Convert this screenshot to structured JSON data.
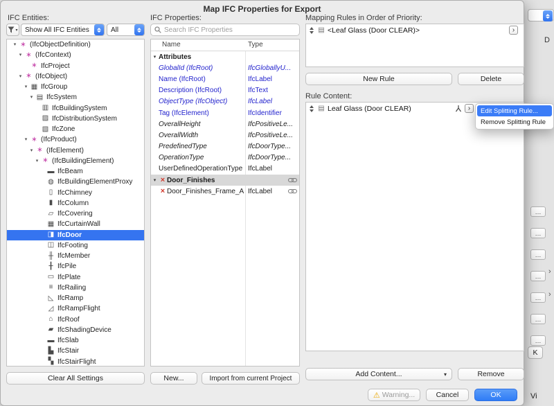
{
  "dialog": {
    "title": "Map IFC Properties for Export"
  },
  "icons": {
    "delete_x": "×",
    "warning": "⚠",
    "chevron_right": "›",
    "dropdown_caret": "▾",
    "rule_item_glyph": "▤"
  },
  "colors": {
    "accent_blue": "#3b7cf7",
    "selection_blue": "#3574f0",
    "attribute_blue": "#2323cd",
    "delete_red": "#d23a2e",
    "warning_yellow": "#eba800"
  },
  "entities_panel": {
    "label": "IFC Entities:",
    "filter_dropdown": "Show All IFC Entities",
    "scope_dropdown": "All",
    "clear_button": "Clear All Settings",
    "tree": [
      {
        "label": "(IfcObjectDefinition)",
        "indent": 0,
        "caret": "▾",
        "glyph": "∗",
        "gc": "#c43fa8",
        "icon": "ifc-class-icon"
      },
      {
        "label": "(IfcContext)",
        "indent": 1,
        "caret": "▾",
        "glyph": "∗",
        "gc": "#c43fa8",
        "icon": "ifc-class-icon"
      },
      {
        "label": "IfcProject",
        "indent": 2,
        "glyph": "∗",
        "gc": "#c43fa8",
        "icon": "project-icon"
      },
      {
        "label": "(IfcObject)",
        "indent": 1,
        "caret": "▾",
        "glyph": "∗",
        "gc": "#c43fa8",
        "icon": "ifc-class-icon"
      },
      {
        "label": "IfcGroup",
        "indent": 2,
        "caret": "▾",
        "glyph": "▦",
        "gc": "#4a4a4a",
        "icon": "group-icon"
      },
      {
        "label": "IfcSystem",
        "indent": 3,
        "caret": "▾",
        "glyph": "▤",
        "gc": "#4a4a4a",
        "icon": "system-icon"
      },
      {
        "label": "IfcBuildingSystem",
        "indent": 4,
        "glyph": "▥",
        "gc": "#4a4a4a",
        "icon": "building-system-icon"
      },
      {
        "label": "IfcDistributionSystem",
        "indent": 4,
        "glyph": "▨",
        "gc": "#4a4a4a",
        "icon": "distribution-system-icon"
      },
      {
        "label": "IfcZone",
        "indent": 4,
        "glyph": "▧",
        "gc": "#4a4a4a",
        "icon": "zone-icon"
      },
      {
        "label": "(IfcProduct)",
        "indent": 2,
        "caret": "▾",
        "glyph": "∗",
        "gc": "#c43fa8",
        "icon": "ifc-class-icon"
      },
      {
        "label": "(IfcElement)",
        "indent": 3,
        "caret": "▾",
        "glyph": "∗",
        "gc": "#c43fa8",
        "icon": "ifc-class-icon"
      },
      {
        "label": "(IfcBuildingElement)",
        "indent": 4,
        "caret": "▾",
        "glyph": "∗",
        "gc": "#c43fa8",
        "icon": "ifc-class-icon"
      },
      {
        "label": "IfcBeam",
        "indent": 5,
        "glyph": "▬",
        "gc": "#4a4a4a",
        "icon": "beam-icon"
      },
      {
        "label": "IfcBuildingElementProxy",
        "indent": 5,
        "glyph": "◍",
        "gc": "#4a4a4a",
        "icon": "building-element-proxy-icon"
      },
      {
        "label": "IfcChimney",
        "indent": 5,
        "glyph": "▯",
        "gc": "#4a4a4a",
        "icon": "chimney-icon"
      },
      {
        "label": "IfcColumn",
        "indent": 5,
        "glyph": "▮",
        "gc": "#4a4a4a",
        "icon": "column-icon"
      },
      {
        "label": "IfcCovering",
        "indent": 5,
        "glyph": "▱",
        "gc": "#4a4a4a",
        "icon": "covering-icon"
      },
      {
        "label": "IfcCurtainWall",
        "indent": 5,
        "glyph": "▦",
        "gc": "#4a4a4a",
        "icon": "curtain-wall-icon"
      },
      {
        "label": "IfcDoor",
        "indent": 5,
        "glyph": "◨",
        "gc": "#ffffff",
        "sel": true,
        "icon": "door-icon"
      },
      {
        "label": "IfcFooting",
        "indent": 5,
        "glyph": "◫",
        "gc": "#4a4a4a",
        "icon": "footing-icon"
      },
      {
        "label": "IfcMember",
        "indent": 5,
        "glyph": "╫",
        "gc": "#4a4a4a",
        "icon": "member-icon"
      },
      {
        "label": "IfcPile",
        "indent": 5,
        "glyph": "╂",
        "gc": "#4a4a4a",
        "icon": "pile-icon"
      },
      {
        "label": "IfcPlate",
        "indent": 5,
        "glyph": "▭",
        "gc": "#4a4a4a",
        "icon": "plate-icon"
      },
      {
        "label": "IfcRailing",
        "indent": 5,
        "glyph": "≡",
        "gc": "#4a4a4a",
        "icon": "railing-icon"
      },
      {
        "label": "IfcRamp",
        "indent": 5,
        "glyph": "◺",
        "gc": "#4a4a4a",
        "icon": "ramp-icon"
      },
      {
        "label": "IfcRampFlight",
        "indent": 5,
        "glyph": "◿",
        "gc": "#4a4a4a",
        "icon": "ramp-flight-icon"
      },
      {
        "label": "IfcRoof",
        "indent": 5,
        "glyph": "⌂",
        "gc": "#4a4a4a",
        "icon": "roof-icon"
      },
      {
        "label": "IfcShadingDevice",
        "indent": 5,
        "glyph": "▰",
        "gc": "#4a4a4a",
        "icon": "shading-device-icon"
      },
      {
        "label": "IfcSlab",
        "indent": 5,
        "glyph": "▬",
        "gc": "#4a4a4a",
        "icon": "slab-icon"
      },
      {
        "label": "IfcStair",
        "indent": 5,
        "glyph": "▙",
        "gc": "#4a4a4a",
        "icon": "stair-icon"
      },
      {
        "label": "IfcStairFlight",
        "indent": 5,
        "glyph": "▚",
        "gc": "#4a4a4a",
        "icon": "stair-flight-icon"
      }
    ]
  },
  "properties_panel": {
    "label": "IFC Properties:",
    "search_placeholder": "Search IFC Properties",
    "columns": {
      "name": "Name",
      "type": "Type"
    },
    "rows": [
      {
        "name": "Attributes",
        "type": "",
        "caret": "▾",
        "bold": true
      },
      {
        "name": "GlobalId (IfcRoot)",
        "type": "IfcGloballyU...",
        "color": "#2323cd",
        "italic": true
      },
      {
        "name": "Name (IfcRoot)",
        "type": "IfcLabel",
        "color": "#2323cd"
      },
      {
        "name": "Description (IfcRoot)",
        "type": "IfcText",
        "color": "#2323cd"
      },
      {
        "name": "ObjectType (IfcObject)",
        "type": "IfcLabel",
        "color": "#2323cd",
        "italic": true
      },
      {
        "name": "Tag (IfcElement)",
        "type": "IfcIdentifier",
        "color": "#2323cd"
      },
      {
        "name": "OverallHeight",
        "type": "IfcPositiveLe...",
        "italic": true
      },
      {
        "name": "OverallWidth",
        "type": "IfcPositiveLe...",
        "italic": true
      },
      {
        "name": "PredefinedType",
        "type": "IfcDoorType...",
        "italic": true
      },
      {
        "name": "OperationType",
        "type": "IfcDoorType...",
        "italic": true
      },
      {
        "name": "UserDefinedOperationType",
        "type": "IfcLabel"
      },
      {
        "name": "Door_Finishes",
        "type": "",
        "caret": "▾",
        "bold": true,
        "xicon": true,
        "chain": true,
        "grayed": true
      },
      {
        "name": "Door_Finishes_Frame_A",
        "type": "IfcLabel",
        "xicon": true,
        "chain": true
      }
    ],
    "new_button": "New...",
    "import_button": "Import from current Project"
  },
  "rules_panel": {
    "mapping_label": "Mapping Rules in Order of Priority:",
    "mapping_rows": [
      {
        "label": "<Leaf Glass (Door CLEAR)>"
      }
    ],
    "new_rule_button": "New Rule",
    "delete_button": "Delete",
    "content_label": "Rule Content:",
    "content_rows": [
      {
        "label": "Leaf Glass (Door CLEAR)"
      }
    ],
    "add_content_button": "Add Content...",
    "remove_button": "Remove"
  },
  "context_menu": {
    "items": [
      {
        "label": "Edit Splitting Rule...",
        "highlighted": true
      },
      {
        "label": "Remove Splitting Rule",
        "highlighted": false
      }
    ]
  },
  "footer": {
    "warning_button": "Warning...",
    "cancel_button": "Cancel",
    "ok_button": "OK"
  },
  "background": {
    "ellipsis": "…",
    "chevron": "›",
    "d_partial": "D",
    "ok_partial": "K",
    "view_partial": "Vi"
  }
}
